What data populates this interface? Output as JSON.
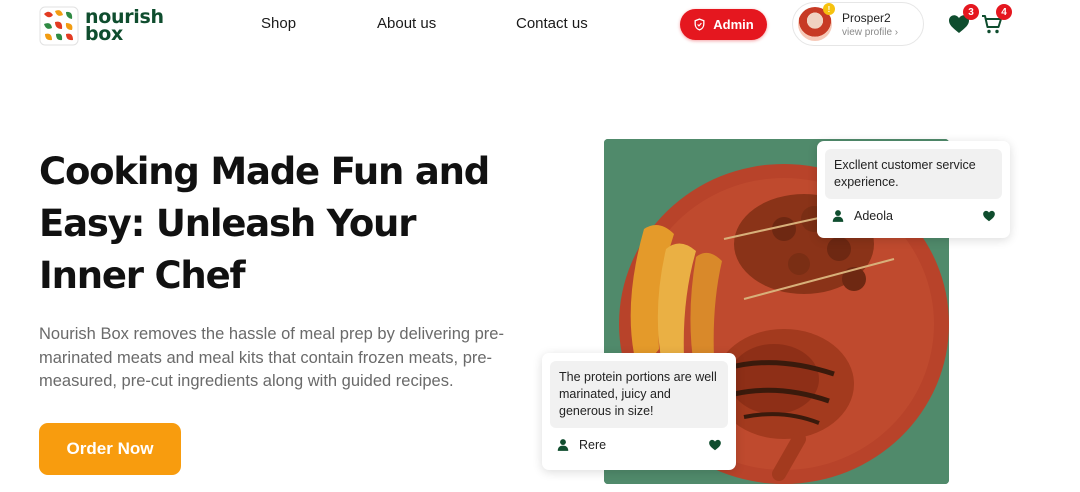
{
  "brand": {
    "line1": "nourish",
    "line2": "box"
  },
  "nav": {
    "shop": "Shop",
    "about": "About us",
    "contact": "Contact us"
  },
  "admin": {
    "label": "Admin"
  },
  "profile": {
    "name": "Prosper2",
    "sub": "view profile ›",
    "badge": "!"
  },
  "wishlist": {
    "count": "3"
  },
  "cart": {
    "count": "4"
  },
  "hero": {
    "title": "Cooking Made Fun and Easy: Unleash Your Inner Chef",
    "description": "Nourish Box removes the hassle of meal prep by delivering pre-marinated meats and meal kits that contain frozen meats, pre-measured, pre-cut ingredients along with guided recipes.",
    "cta": "Order Now"
  },
  "reviews": [
    {
      "text": "Excllent customer service experience.",
      "author": "Adeola"
    },
    {
      "text": "The protein portions are well marinated, juicy and generous in size!",
      "author": "Rere"
    }
  ],
  "colors": {
    "brand_green": "#0f4d2e",
    "accent_orange": "#f89c0e",
    "alert_red": "#e5171f"
  }
}
